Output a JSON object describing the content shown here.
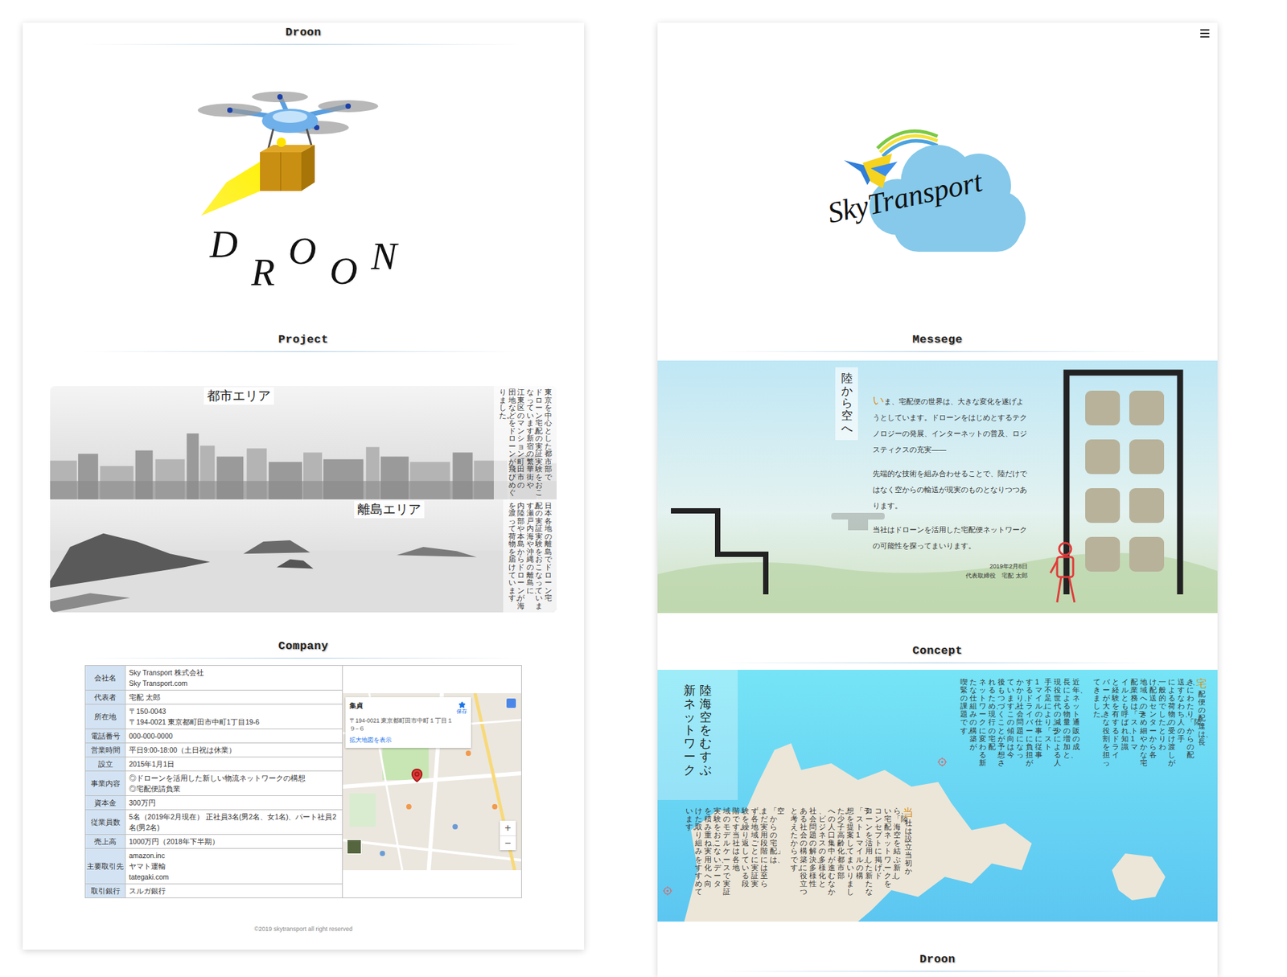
{
  "droon_page": {
    "heading_top": "Droon",
    "logo": {
      "letters": [
        "D",
        "R",
        "O",
        "O",
        "N"
      ]
    },
    "project": {
      "heading": "Project",
      "areas": [
        {
          "label": "都市エリア",
          "kind": "city",
          "columns": [
            "東京を中心とした都市部で",
            "ドローン宅配の実証実験をおこ",
            "なっています。新宿の繁華街や",
            "江東区のマンション、町田市の",
            "団地などをドローンが飛びめぐ",
            "りました。"
          ]
        },
        {
          "label": "離島エリア",
          "kind": "island",
          "columns": [
            "日本各地の離島でドローン宅",
            "配の実証実験をおこなっていま",
            "す。瀬戸内海や沖縄の離島に、",
            "内陸部や本島からドローンが海",
            "を渡って荷物を届けています。"
          ]
        }
      ]
    },
    "company": {
      "heading": "Company",
      "rows": [
        {
          "label": "会社名",
          "lines": [
            "Sky Transport 株式会社",
            "Sky Transport.com"
          ]
        },
        {
          "label": "代表者",
          "lines": [
            "宅配 太郎"
          ]
        },
        {
          "label": "所在地",
          "lines": [
            "〒150-0043",
            "〒194-0021 東京都町田市中町1丁目19-6"
          ]
        },
        {
          "label": "電話番号",
          "lines": [
            "000-000-0000"
          ]
        },
        {
          "label": "営業時間",
          "lines": [
            "平日9:00-18:00（土日祝は休業）"
          ]
        },
        {
          "label": "設立",
          "lines": [
            "2015年1月1日"
          ]
        },
        {
          "label": "事業内容",
          "lines": [
            "◎ドローンを活用した新しい物流ネットワークの構想",
            "◎宅配便請負業"
          ]
        },
        {
          "label": "資本金",
          "lines": [
            "300万円"
          ]
        },
        {
          "label": "従業員数",
          "lines": [
            "5名（2019年2月現在） 正社員3名(男2名、女1名)、パート社員2名(男2名)"
          ]
        },
        {
          "label": "売上高",
          "lines": [
            "1000万円（2018年下半期）"
          ]
        },
        {
          "label": "主要取引先",
          "lines": [
            "amazon.inc",
            "ヤマト運輸",
            "tategaki.com"
          ]
        },
        {
          "label": "取引銀行",
          "lines": [
            "スルガ銀行"
          ]
        }
      ],
      "map": {
        "place": "集貞",
        "address": "〒194-0021 東京都町田市中町１丁目１９−６",
        "link": "拡大地図を表示",
        "save": "保存",
        "zoom_in": "+",
        "zoom_out": "−"
      }
    },
    "footer": "©2019 skytransport all right reserved"
  },
  "sky_page": {
    "logo": "SkyTransport",
    "message": {
      "heading": "Messege",
      "title": "陸から空へ",
      "cap": "い",
      "paragraphs": [
        "ま、宅配便の世界は、大きな変化を遂げようとしています。ドローンをはじめとするテクノロジーの発展、インターネットの普及、ロジスティクスの充実——",
        "先端的な技術を組み合わせることで、陸だけではなく空からの輸送が現実のものとなりつつあります。",
        "当社はドローンを活用した宅配便ネットワークの可能性を探ってまいります。"
      ],
      "date": "2019年2月8日",
      "signature": "代表取締役　宅配 太郎"
    },
    "concept": {
      "heading": "Concept",
      "title_columns": [
        "陸海空をむすぶ",
        "新ネットワーク"
      ],
      "top": [
        {
          "cap": "宅",
          "columns": [
            "配便の配達は、長",
            "きにわたり「陸からの配",
            "送」、すなわち、人の手",
            "による荷物の受け渡しが",
            "一般的でした。とりわ",
            "け、配送センターから各",
            "地域へのきめ細やかな宅",
            "配業務は、「ラスト1マ",
            "イル」とも呼ばれ、知識",
            "と経験を有するドライ",
            "バーが大きな役割を担っ",
            "てきました。"
          ]
        },
        {
          "columns": [
            "近年、ネット通販の成",
            "長による物量の増加と、",
            "現役世代の減少による人",
            "手不足により、「ラスト",
            "1マイル」の仕事に従事",
            "するドライバーに負担が",
            "かかり、社会問題になっ",
            "ています。この傾向は今",
            "後もつづくことが予想さ",
            "れるため、現行の宅配",
            "ネットワークに変わる新",
            "たな仕組みの構築が",
            "喫緊の課題です。"
          ]
        }
      ],
      "bottom": [
        {
          "cap": "当",
          "columns": [
            "社は設立当初か",
            "ら、「陸海空を結ぶ新し",
            "い宅配ネットワーク」を",
            "コンセプトに掲げ、ド",
            "ローンを活用した新たな",
            "「ラスト1マイル」の構",
            "想を提案してまいりまし",
            "た。少子高齢化、都市部",
            "への人口集中が進むなか",
            "、ビジネスの多様化と",
            "社会問題の解決、多様性",
            "ある社会の構築に役立つ",
            "と考えたからです。"
          ]
        },
        {
          "columns": [
            "「空からの宅配」は、",
            "まだ実用段階には至ら",
            "ず、各地域ごとに実証実",
            "験を繰り返している段",
            "階です。当社は各地",
            "域のモデルケースで実証",
            "実験をおこない、データ",
            "を積み重ね、実用化へ向",
            "けた取り組みをすすめて",
            "います。"
          ]
        }
      ]
    },
    "next_heading": "Droon"
  }
}
